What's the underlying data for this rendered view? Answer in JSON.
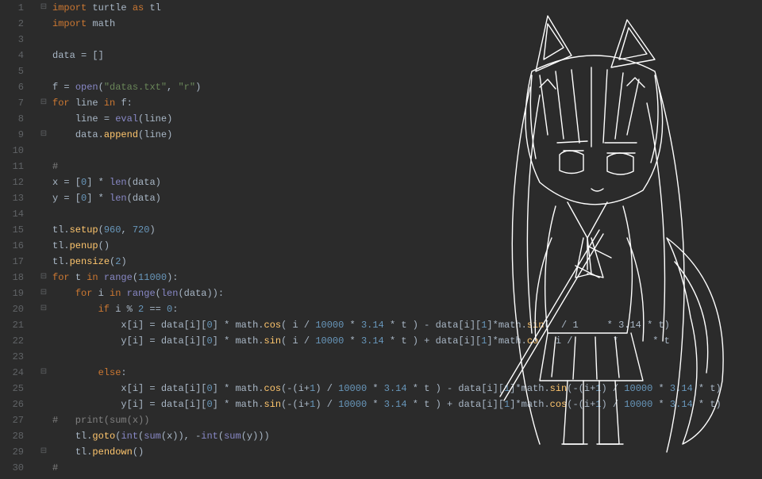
{
  "lines": [
    {
      "num": "1",
      "fold": "⊟",
      "tokens": [
        [
          "k",
          "import "
        ],
        [
          "id",
          "turtle "
        ],
        [
          "k",
          "as "
        ],
        [
          "id",
          "tl"
        ]
      ]
    },
    {
      "num": "2",
      "fold": "",
      "tokens": [
        [
          "k",
          "import "
        ],
        [
          "id",
          "math"
        ]
      ]
    },
    {
      "num": "3",
      "fold": "",
      "tokens": []
    },
    {
      "num": "4",
      "fold": "",
      "tokens": [
        [
          "id",
          "data "
        ],
        [
          "op",
          "= []"
        ]
      ]
    },
    {
      "num": "5",
      "fold": "",
      "tokens": []
    },
    {
      "num": "6",
      "fold": "",
      "tokens": [
        [
          "id",
          "f "
        ],
        [
          "op",
          "= "
        ],
        [
          "bi",
          "open"
        ],
        [
          "op",
          "("
        ],
        [
          "s",
          "\"datas.txt\""
        ],
        [
          "op",
          ", "
        ],
        [
          "s",
          "\"r\""
        ],
        [
          "op",
          ")"
        ]
      ]
    },
    {
      "num": "7",
      "fold": "⊟",
      "tokens": [
        [
          "k",
          "for "
        ],
        [
          "id",
          "line "
        ],
        [
          "k",
          "in "
        ],
        [
          "id",
          "f"
        ],
        [
          "op",
          ":"
        ]
      ]
    },
    {
      "num": "8",
      "fold": "",
      "tokens": [
        [
          "op",
          "    "
        ],
        [
          "id",
          "line "
        ],
        [
          "op",
          "= "
        ],
        [
          "bi",
          "eval"
        ],
        [
          "op",
          "("
        ],
        [
          "id",
          "line"
        ],
        [
          "op",
          ")"
        ]
      ]
    },
    {
      "num": "9",
      "fold": "⊟",
      "tokens": [
        [
          "op",
          "    "
        ],
        [
          "id",
          "data"
        ],
        [
          "op",
          "."
        ],
        [
          "f",
          "append"
        ],
        [
          "op",
          "("
        ],
        [
          "id",
          "line"
        ],
        [
          "op",
          ")"
        ]
      ]
    },
    {
      "num": "10",
      "fold": "",
      "tokens": []
    },
    {
      "num": "11",
      "fold": "",
      "tokens": [
        [
          "c",
          "#"
        ]
      ]
    },
    {
      "num": "12",
      "fold": "",
      "tokens": [
        [
          "id",
          "x "
        ],
        [
          "op",
          "= ["
        ],
        [
          "n",
          "0"
        ],
        [
          "op",
          "] * "
        ],
        [
          "bi",
          "len"
        ],
        [
          "op",
          "("
        ],
        [
          "id",
          "data"
        ],
        [
          "op",
          ")"
        ]
      ]
    },
    {
      "num": "13",
      "fold": "",
      "tokens": [
        [
          "id",
          "y "
        ],
        [
          "op",
          "= ["
        ],
        [
          "n",
          "0"
        ],
        [
          "op",
          "] * "
        ],
        [
          "bi",
          "len"
        ],
        [
          "op",
          "("
        ],
        [
          "id",
          "data"
        ],
        [
          "op",
          ")"
        ]
      ]
    },
    {
      "num": "14",
      "fold": "",
      "tokens": []
    },
    {
      "num": "15",
      "fold": "",
      "tokens": [
        [
          "id",
          "tl"
        ],
        [
          "op",
          "."
        ],
        [
          "f",
          "setup"
        ],
        [
          "op",
          "("
        ],
        [
          "n",
          "960"
        ],
        [
          "op",
          ", "
        ],
        [
          "n",
          "720"
        ],
        [
          "op",
          ")"
        ]
      ]
    },
    {
      "num": "16",
      "fold": "",
      "tokens": [
        [
          "id",
          "tl"
        ],
        [
          "op",
          "."
        ],
        [
          "f",
          "penup"
        ],
        [
          "op",
          "()"
        ]
      ]
    },
    {
      "num": "17",
      "fold": "",
      "tokens": [
        [
          "id",
          "tl"
        ],
        [
          "op",
          "."
        ],
        [
          "f",
          "pensize"
        ],
        [
          "op",
          "("
        ],
        [
          "n",
          "2"
        ],
        [
          "op",
          ")"
        ]
      ]
    },
    {
      "num": "18",
      "fold": "⊟",
      "tokens": [
        [
          "k",
          "for "
        ],
        [
          "id",
          "t "
        ],
        [
          "k",
          "in "
        ],
        [
          "bi",
          "range"
        ],
        [
          "op",
          "("
        ],
        [
          "n",
          "11000"
        ],
        [
          "op",
          "):"
        ]
      ]
    },
    {
      "num": "19",
      "fold": "⊟",
      "tokens": [
        [
          "op",
          "    "
        ],
        [
          "k",
          "for "
        ],
        [
          "id",
          "i "
        ],
        [
          "k",
          "in "
        ],
        [
          "bi",
          "range"
        ],
        [
          "op",
          "("
        ],
        [
          "bi",
          "len"
        ],
        [
          "op",
          "("
        ],
        [
          "id",
          "data"
        ],
        [
          "op",
          ")):"
        ]
      ]
    },
    {
      "num": "20",
      "fold": "⊟",
      "tokens": [
        [
          "op",
          "        "
        ],
        [
          "k",
          "if "
        ],
        [
          "id",
          "i "
        ],
        [
          "op",
          "% "
        ],
        [
          "n",
          "2"
        ],
        [
          "op",
          " == "
        ],
        [
          "n",
          "0"
        ],
        [
          "op",
          ":"
        ]
      ]
    },
    {
      "num": "21",
      "fold": "",
      "tokens": [
        [
          "op",
          "            "
        ],
        [
          "id",
          "x"
        ],
        [
          "op",
          "["
        ],
        [
          "id",
          "i"
        ],
        [
          "op",
          "] = "
        ],
        [
          "id",
          "data"
        ],
        [
          "op",
          "["
        ],
        [
          "id",
          "i"
        ],
        [
          "op",
          "]["
        ],
        [
          "n",
          "0"
        ],
        [
          "op",
          "] * "
        ],
        [
          "id",
          "math"
        ],
        [
          "op",
          "."
        ],
        [
          "f",
          "cos"
        ],
        [
          "op",
          "( "
        ],
        [
          "id",
          "i"
        ],
        [
          "op",
          " / "
        ],
        [
          "n",
          "10000"
        ],
        [
          "op",
          " * "
        ],
        [
          "n",
          "3.14"
        ],
        [
          "op",
          " * "
        ],
        [
          "id",
          "t"
        ],
        [
          "op",
          " ) - "
        ],
        [
          "id",
          "data"
        ],
        [
          "op",
          "["
        ],
        [
          "id",
          "i"
        ],
        [
          "op",
          "]["
        ],
        [
          "n",
          "1"
        ],
        [
          "op",
          "]*"
        ],
        [
          "id",
          "math"
        ],
        [
          "op",
          "."
        ],
        [
          "f",
          "sin"
        ],
        [
          "op",
          "(  / 1     * 3.14 * t)"
        ]
      ]
    },
    {
      "num": "22",
      "fold": "",
      "tokens": [
        [
          "op",
          "            "
        ],
        [
          "id",
          "y"
        ],
        [
          "op",
          "["
        ],
        [
          "id",
          "i"
        ],
        [
          "op",
          "] = "
        ],
        [
          "id",
          "data"
        ],
        [
          "op",
          "["
        ],
        [
          "id",
          "i"
        ],
        [
          "op",
          "]["
        ],
        [
          "n",
          "0"
        ],
        [
          "op",
          "] * "
        ],
        [
          "id",
          "math"
        ],
        [
          "op",
          "."
        ],
        [
          "f",
          "sin"
        ],
        [
          "op",
          "( "
        ],
        [
          "id",
          "i"
        ],
        [
          "op",
          " / "
        ],
        [
          "n",
          "10000"
        ],
        [
          "op",
          " * "
        ],
        [
          "n",
          "3.14"
        ],
        [
          "op",
          " * "
        ],
        [
          "id",
          "t"
        ],
        [
          "op",
          " ) + "
        ],
        [
          "id",
          "data"
        ],
        [
          "op",
          "["
        ],
        [
          "id",
          "i"
        ],
        [
          "op",
          "]["
        ],
        [
          "n",
          "1"
        ],
        [
          "op",
          "]*"
        ],
        [
          "id",
          "math"
        ],
        [
          "op",
          "."
        ],
        [
          "f",
          "co"
        ],
        [
          "op",
          "   i /       *      * t"
        ]
      ]
    },
    {
      "num": "23",
      "fold": "",
      "tokens": []
    },
    {
      "num": "24",
      "fold": "⊟",
      "tokens": [
        [
          "op",
          "        "
        ],
        [
          "k",
          "else"
        ],
        [
          "op",
          ":"
        ]
      ]
    },
    {
      "num": "25",
      "fold": "",
      "tokens": [
        [
          "op",
          "            "
        ],
        [
          "id",
          "x"
        ],
        [
          "op",
          "["
        ],
        [
          "id",
          "i"
        ],
        [
          "op",
          "] = "
        ],
        [
          "id",
          "data"
        ],
        [
          "op",
          "["
        ],
        [
          "id",
          "i"
        ],
        [
          "op",
          "]["
        ],
        [
          "n",
          "0"
        ],
        [
          "op",
          "] * "
        ],
        [
          "id",
          "math"
        ],
        [
          "op",
          "."
        ],
        [
          "f",
          "cos"
        ],
        [
          "op",
          "(-("
        ],
        [
          "id",
          "i"
        ],
        [
          "op",
          "+"
        ],
        [
          "n",
          "1"
        ],
        [
          "op",
          ") / "
        ],
        [
          "n",
          "10000"
        ],
        [
          "op",
          " * "
        ],
        [
          "n",
          "3.14"
        ],
        [
          "op",
          " * "
        ],
        [
          "id",
          "t"
        ],
        [
          "op",
          " ) - "
        ],
        [
          "id",
          "data"
        ],
        [
          "op",
          "["
        ],
        [
          "id",
          "i"
        ],
        [
          "op",
          "]["
        ],
        [
          "n",
          "1"
        ],
        [
          "op",
          "]*"
        ],
        [
          "id",
          "math"
        ],
        [
          "op",
          "."
        ],
        [
          "f",
          "sin"
        ],
        [
          "op",
          "(-("
        ],
        [
          "id",
          "i"
        ],
        [
          "op",
          "+"
        ],
        [
          "n",
          "1"
        ],
        [
          "op",
          ") / "
        ],
        [
          "n",
          "10000"
        ],
        [
          "op",
          " * "
        ],
        [
          "n",
          "3.14"
        ],
        [
          "op",
          " * "
        ],
        [
          "id",
          "t"
        ],
        [
          "op",
          ")"
        ]
      ]
    },
    {
      "num": "26",
      "fold": "",
      "tokens": [
        [
          "op",
          "            "
        ],
        [
          "id",
          "y"
        ],
        [
          "op",
          "["
        ],
        [
          "id",
          "i"
        ],
        [
          "op",
          "] = "
        ],
        [
          "id",
          "data"
        ],
        [
          "op",
          "["
        ],
        [
          "id",
          "i"
        ],
        [
          "op",
          "]["
        ],
        [
          "n",
          "0"
        ],
        [
          "op",
          "] * "
        ],
        [
          "id",
          "math"
        ],
        [
          "op",
          "."
        ],
        [
          "f",
          "sin"
        ],
        [
          "op",
          "(-("
        ],
        [
          "id",
          "i"
        ],
        [
          "op",
          "+"
        ],
        [
          "n",
          "1"
        ],
        [
          "op",
          ") / "
        ],
        [
          "n",
          "10000"
        ],
        [
          "op",
          " * "
        ],
        [
          "n",
          "3.14"
        ],
        [
          "op",
          " * "
        ],
        [
          "id",
          "t"
        ],
        [
          "op",
          " ) + "
        ],
        [
          "id",
          "data"
        ],
        [
          "op",
          "["
        ],
        [
          "id",
          "i"
        ],
        [
          "op",
          "]["
        ],
        [
          "n",
          "1"
        ],
        [
          "op",
          "]*"
        ],
        [
          "id",
          "math"
        ],
        [
          "op",
          "."
        ],
        [
          "f",
          "cos"
        ],
        [
          "op",
          "(-("
        ],
        [
          "id",
          "i"
        ],
        [
          "op",
          "+"
        ],
        [
          "n",
          "1"
        ],
        [
          "op",
          ") / "
        ],
        [
          "n",
          "10000"
        ],
        [
          "op",
          " * "
        ],
        [
          "n",
          "3.14"
        ],
        [
          "op",
          " * "
        ],
        [
          "id",
          "t"
        ],
        [
          "op",
          ")"
        ]
      ]
    },
    {
      "num": "27",
      "fold": "",
      "tokens": [
        [
          "c",
          "#   print(sum(x))"
        ]
      ]
    },
    {
      "num": "28",
      "fold": "",
      "tokens": [
        [
          "op",
          "    "
        ],
        [
          "id",
          "tl"
        ],
        [
          "op",
          "."
        ],
        [
          "f",
          "goto"
        ],
        [
          "op",
          "("
        ],
        [
          "bi",
          "int"
        ],
        [
          "op",
          "("
        ],
        [
          "bi",
          "sum"
        ],
        [
          "op",
          "("
        ],
        [
          "id",
          "x"
        ],
        [
          "op",
          ")), -"
        ],
        [
          "bi",
          "int"
        ],
        [
          "op",
          "("
        ],
        [
          "bi",
          "sum"
        ],
        [
          "op",
          "("
        ],
        [
          "id",
          "y"
        ],
        [
          "op",
          ")))"
        ]
      ]
    },
    {
      "num": "29",
      "fold": "⊟",
      "tokens": [
        [
          "op",
          "    "
        ],
        [
          "id",
          "tl"
        ],
        [
          "op",
          "."
        ],
        [
          "f",
          "pendown"
        ],
        [
          "op",
          "()"
        ]
      ]
    },
    {
      "num": "30",
      "fold": "",
      "tokens": [
        [
          "c",
          "#"
        ]
      ]
    }
  ]
}
